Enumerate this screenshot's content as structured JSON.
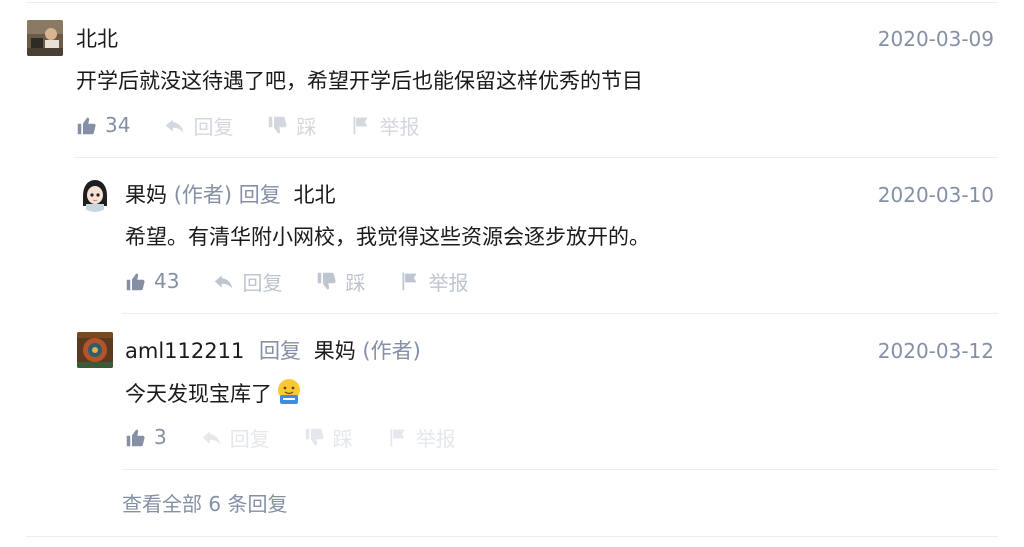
{
  "comments": [
    {
      "author": "北北",
      "date": "2020-03-09",
      "content": "开学后就没这待遇了吧，希望开学后也能保留这样优秀的节目",
      "likes": "34",
      "reply_label": "回复",
      "dislike_label": "踩",
      "report_label": "举报"
    },
    {
      "author": "果妈",
      "author_tag": "(作者)",
      "reply_word": "回复",
      "reply_to": "北北",
      "date": "2020-03-10",
      "content": "希望。有清华附小网校，我觉得这些资源会逐步放开的。",
      "likes": "43",
      "reply_label": "回复",
      "dislike_label": "踩",
      "report_label": "举报"
    },
    {
      "author": "aml112211",
      "reply_word": "回复",
      "reply_to": "果妈",
      "reply_to_tag": "(作者)",
      "date": "2020-03-12",
      "content": "今天发现宝库了",
      "emoji": "like-emoji",
      "likes": "3",
      "reply_label": "回复",
      "dislike_label": "踩",
      "report_label": "举报"
    }
  ],
  "view_all": "查看全部 6 条回复",
  "colors": {
    "secondary": "#8590a6",
    "muted": "#d3d8df",
    "divider": "#eeeeee"
  }
}
